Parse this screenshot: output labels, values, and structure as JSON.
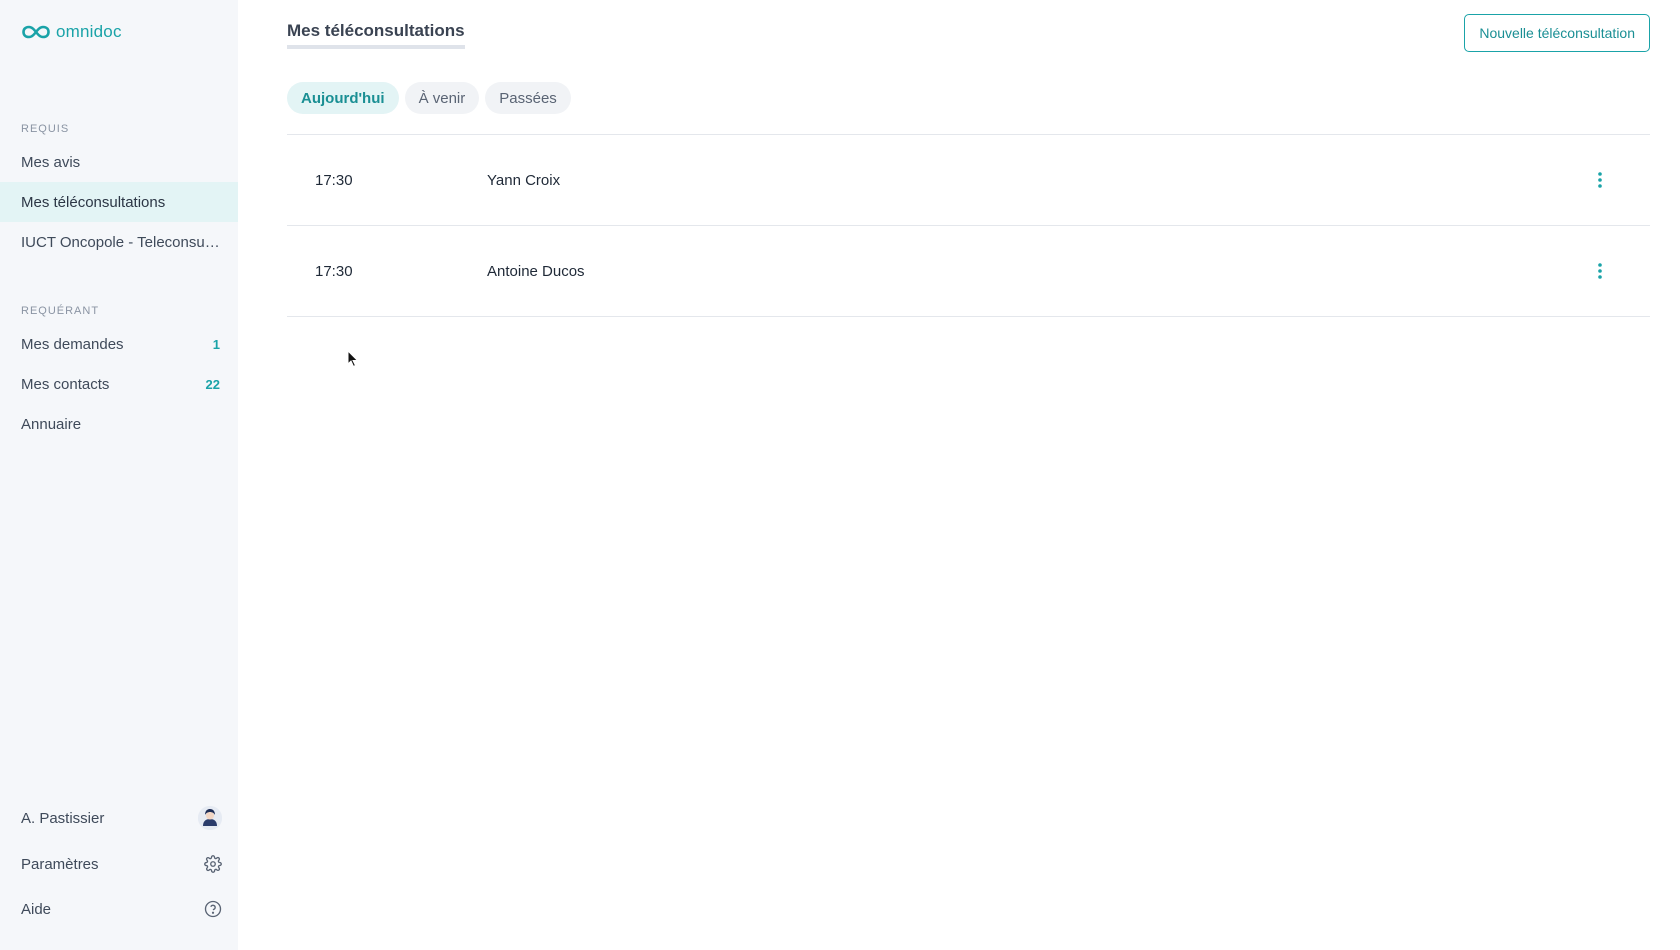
{
  "app": {
    "logo_text": "omnidoc"
  },
  "sidebar": {
    "sections": [
      {
        "label": "REQUIS",
        "items": [
          {
            "label": "Mes avis",
            "active": false
          },
          {
            "label": "Mes téléconsultations",
            "active": true
          },
          {
            "label": "IUCT Oncopole - Teleconsult..."
          }
        ]
      },
      {
        "label": "REQUÉRANT",
        "items": [
          {
            "label": "Mes demandes",
            "count": "1"
          },
          {
            "label": "Mes contacts",
            "count": "22"
          },
          {
            "label": "Annuaire"
          }
        ]
      }
    ],
    "bottom": {
      "user_name": "A. Pastissier",
      "settings_label": "Paramètres",
      "help_label": "Aide"
    }
  },
  "main": {
    "title": "Mes téléconsultations",
    "new_button_label": "Nouvelle téléconsultation",
    "tabs": [
      {
        "label": "Aujourd'hui",
        "active": true
      },
      {
        "label": "À venir",
        "active": false
      },
      {
        "label": "Passées",
        "active": false
      }
    ],
    "rows": [
      {
        "time": "17:30",
        "name": "Yann Croix"
      },
      {
        "time": "17:30",
        "name": "Antoine Ducos"
      }
    ]
  },
  "colors": {
    "accent": "#1aa3a8",
    "sidebar_bg": "#f5f7fa",
    "active_bg": "#e3f4f5"
  },
  "icons": [
    "omnidoc-logo-icon",
    "avatar-icon",
    "gear-icon",
    "help-circle-icon",
    "kebab-menu-icon",
    "mouse-cursor-icon"
  ]
}
